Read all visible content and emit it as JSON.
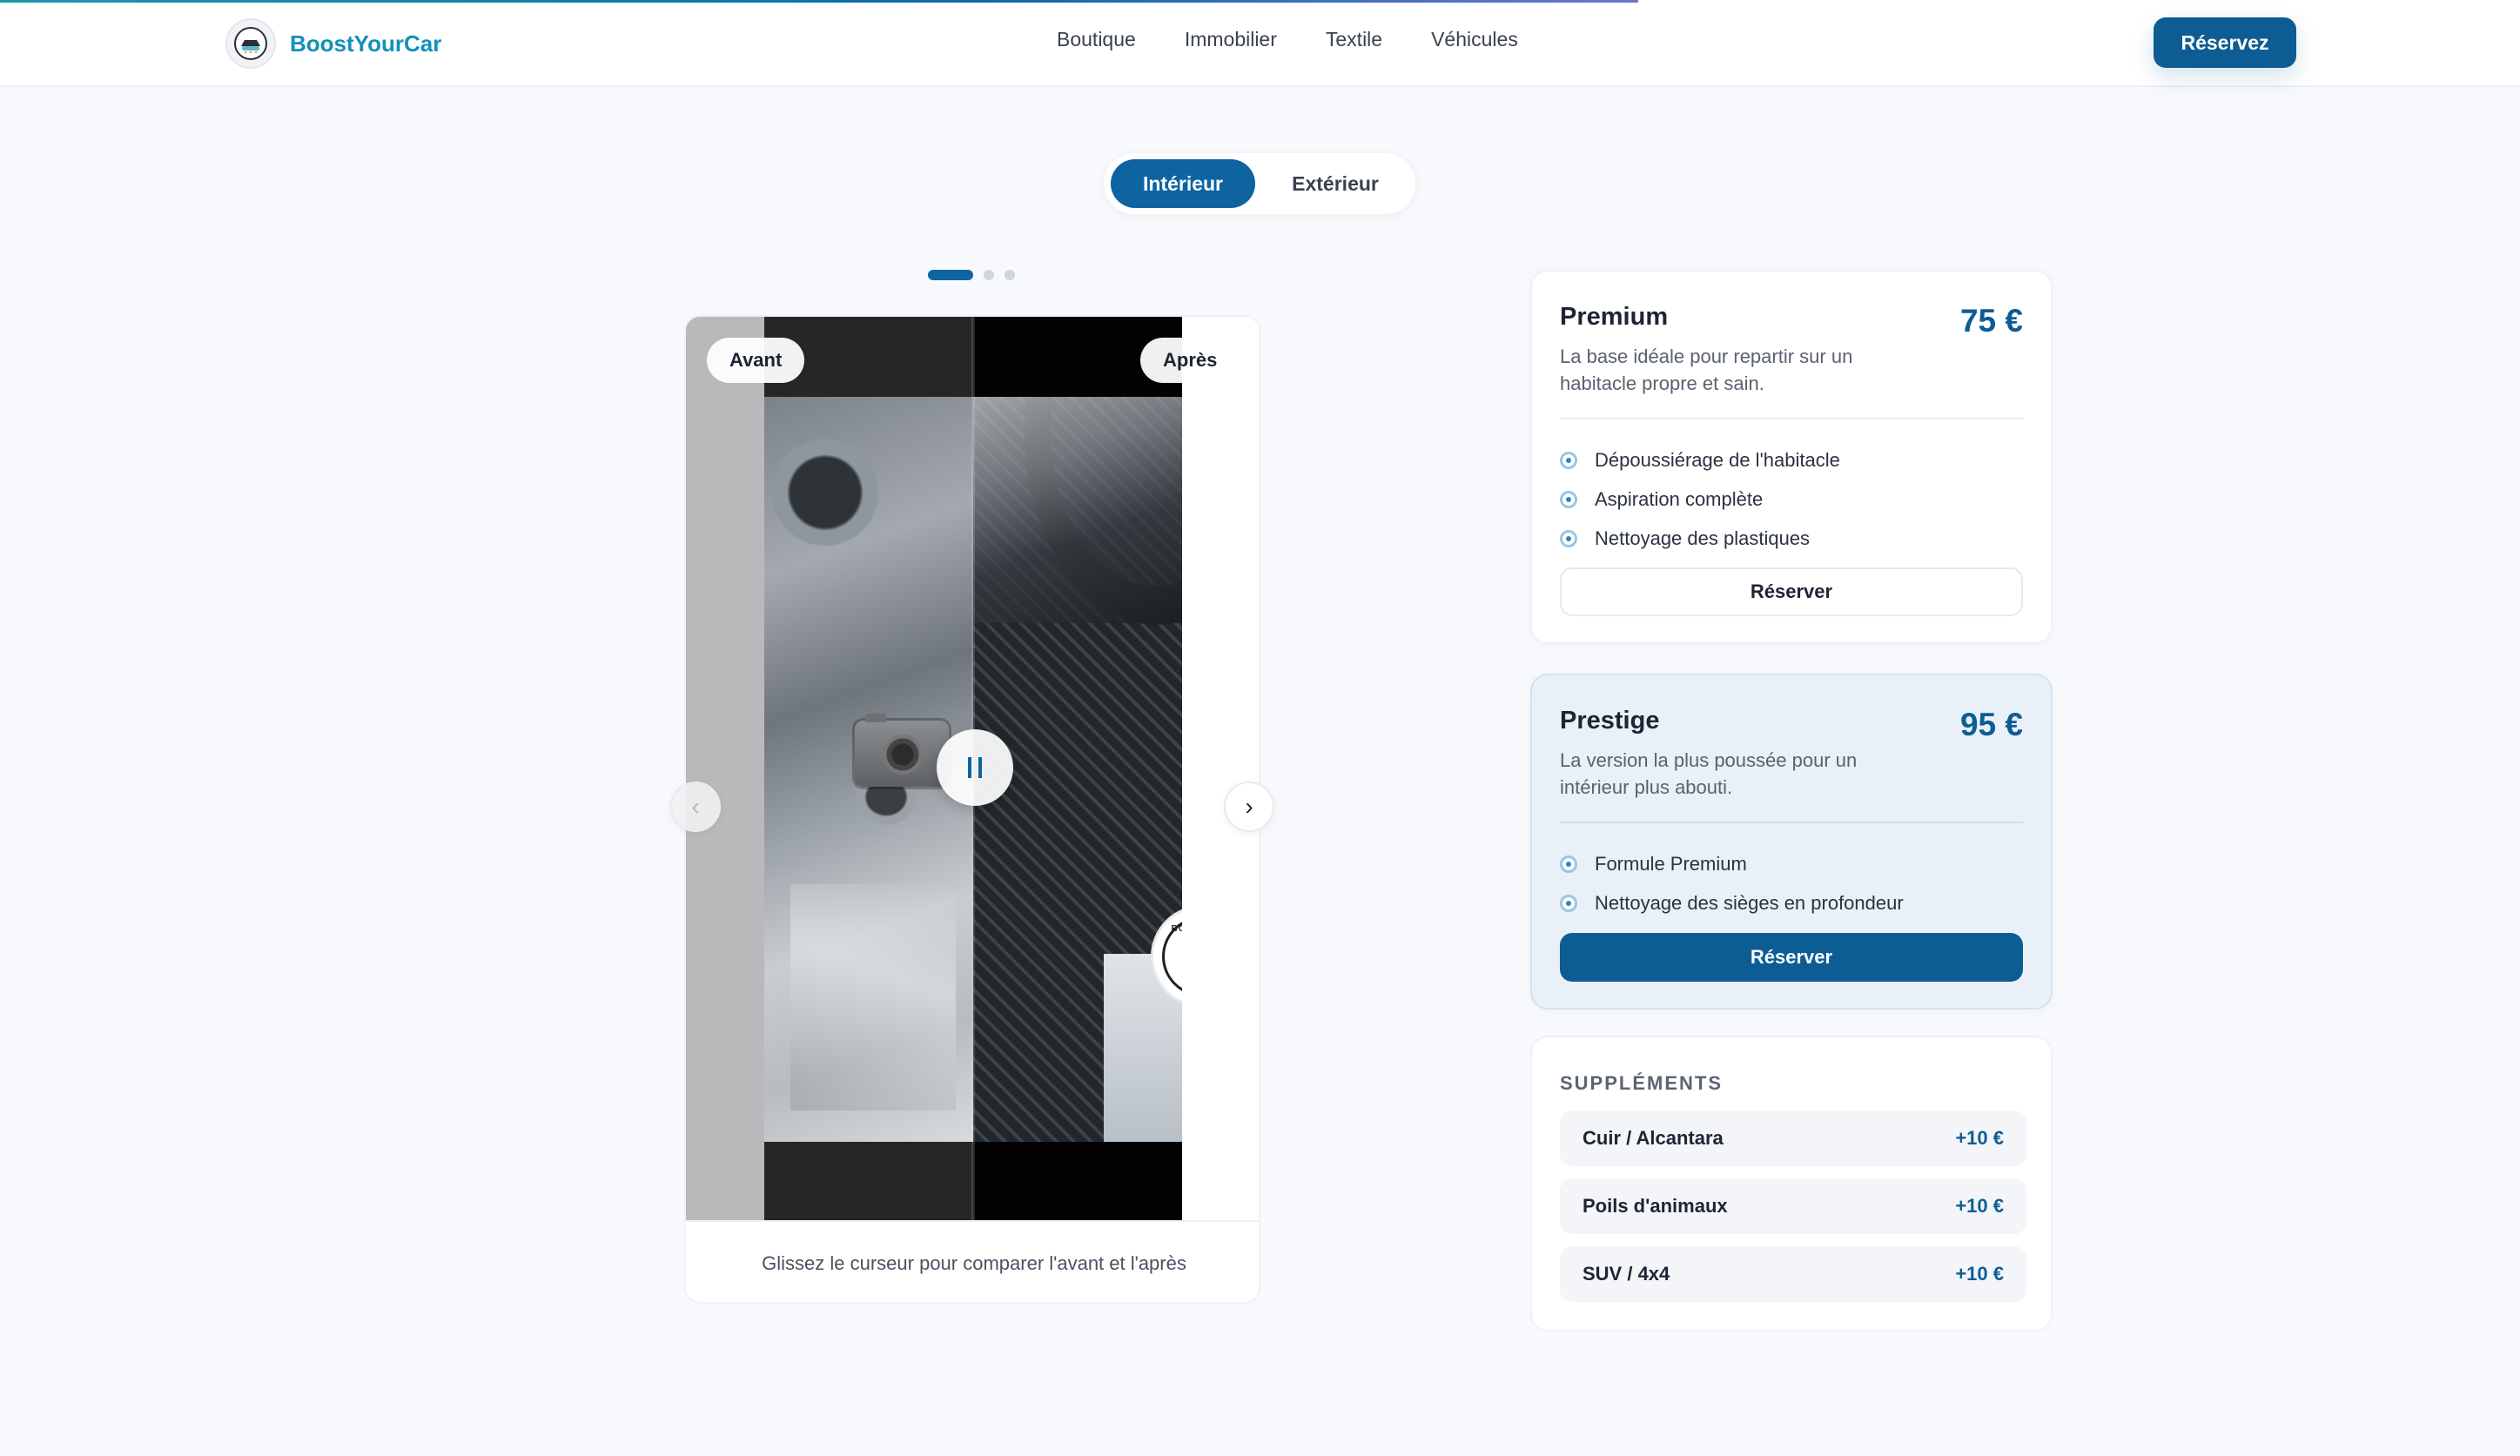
{
  "header": {
    "brand": "BoostYourCar",
    "nav": [
      "Boutique",
      "Immobilier",
      "Textile",
      "Véhicules"
    ],
    "cta": "Réservez"
  },
  "toggle": {
    "options": [
      "Intérieur",
      "Extérieur"
    ],
    "active": "Intérieur"
  },
  "carousel": {
    "slides": 3,
    "active_slide": 1
  },
  "comparison": {
    "before_label": "Avant",
    "after_label": "Après",
    "caption": "Glissez le curseur pour comparer l'avant et l'après",
    "slider_position": 0.5
  },
  "plans": [
    {
      "name": "Premium",
      "price": "75 €",
      "description": "La base idéale pour repartir sur un habitacle propre et sain.",
      "features": [
        "Dépoussiérage de l'habitacle",
        "Aspiration complète",
        "Nettoyage des plastiques"
      ],
      "button": "Réserver"
    },
    {
      "name": "Prestige",
      "price": "95 €",
      "description": "La version la plus poussée pour un intérieur plus abouti.",
      "features": [
        "Formule Premium",
        "Nettoyage des sièges en profondeur"
      ],
      "button": "Réserver"
    }
  ],
  "supplements": {
    "title": "SUPPLÉMENTS",
    "items": [
      {
        "name": "Cuir / Alcantara",
        "price": "+10 €"
      },
      {
        "name": "Poils d'animaux",
        "price": "+10 €"
      },
      {
        "name": "SUV / 4x4",
        "price": "+10 €"
      }
    ]
  },
  "watermark": {
    "text": "BOOST YOUR CAR"
  },
  "colors": {
    "primary": "#0d5d94",
    "brand": "#1390b8",
    "background": "#f7f9fc"
  },
  "icons": [
    "logo-icon",
    "camera-icon",
    "pause-icon",
    "chevron-left-icon",
    "chevron-right-icon",
    "check-circle-icon"
  ]
}
